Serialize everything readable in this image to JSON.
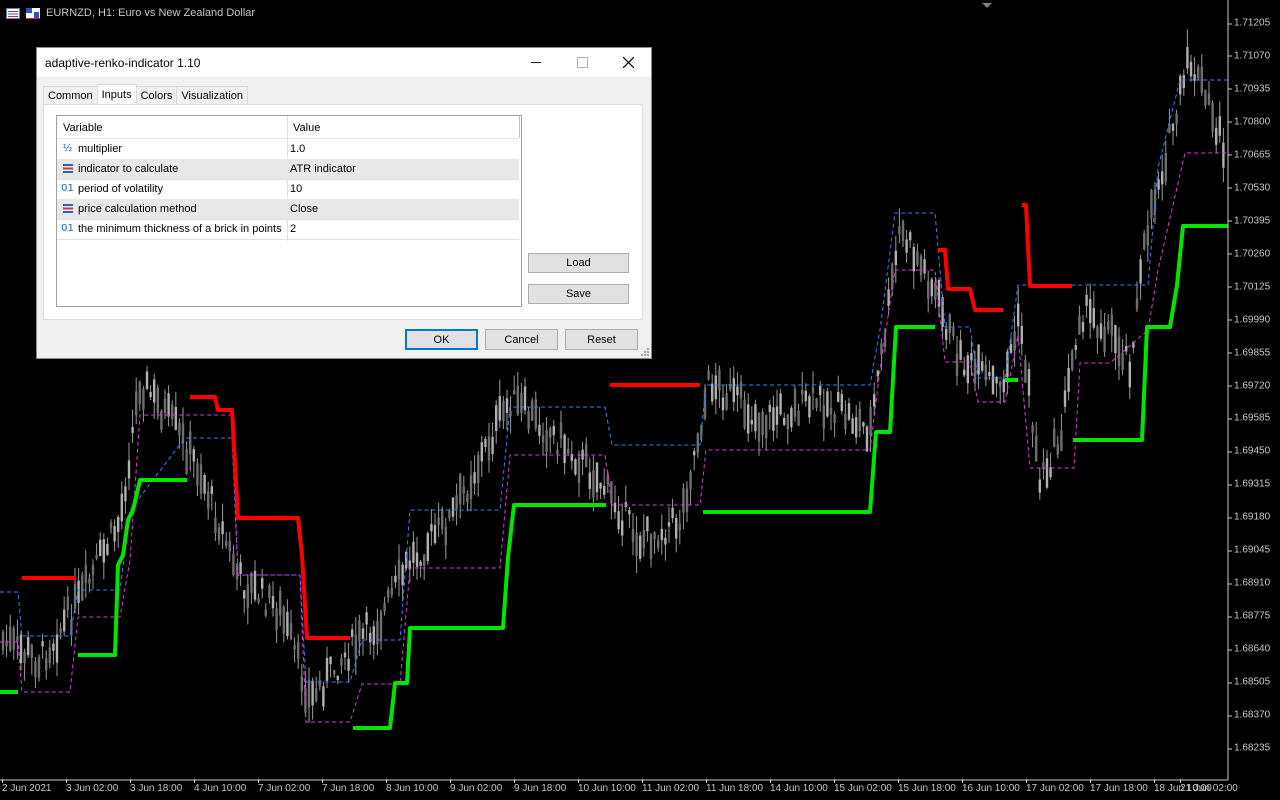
{
  "chart": {
    "symbol_title": "EURNZD, H1:  Euro vs New Zealand Dollar",
    "background": "#000000",
    "candle_color": "#c0c0c0",
    "renko_up_color": "#00e600",
    "renko_down_color": "#ff0000",
    "upper_band_color": "#3c7ff0",
    "lower_band_color": "#d63cd6",
    "price_scale": {
      "min": 1.6815,
      "max": 1.7128
    },
    "price_ticks": [
      "1.71205",
      "1.71070",
      "1.70935",
      "1.70800",
      "1.70665",
      "1.70530",
      "1.70395",
      "1.70260",
      "1.70125",
      "1.69990",
      "1.69855",
      "1.69720",
      "1.69585",
      "1.69450",
      "1.69315",
      "1.69180",
      "1.69045",
      "1.68910",
      "1.68775",
      "1.68640",
      "1.68505",
      "1.68370",
      "1.68235"
    ],
    "time_ticks": [
      "2 Jun 2021",
      "3 Jun 02:00",
      "3 Jun 18:00",
      "4 Jun 10:00",
      "7 Jun 02:00",
      "7 Jun 18:00",
      "8 Jun 10:00",
      "9 Jun 02:00",
      "9 Jun 18:00",
      "10 Jun 10:00",
      "11 Jun 02:00",
      "11 Jun 18:00",
      "14 Jun 10:00",
      "15 Jun 02:00",
      "15 Jun 18:00",
      "16 Jun 10:00",
      "17 Jun 02:00",
      "17 Jun 18:00",
      "18 Jun 10:00",
      "21 Jun 02:00"
    ]
  },
  "dialog": {
    "title": "adaptive-renko-indicator 1.10",
    "tabs": [
      {
        "label": "Common"
      },
      {
        "label": "Inputs"
      },
      {
        "label": "Colors"
      },
      {
        "label": "Visualization"
      }
    ],
    "grid": {
      "header_variable": "Variable",
      "header_value": "Value",
      "rows": [
        {
          "icon": "fraction-icon",
          "name": "multiplier",
          "value": "1.0"
        },
        {
          "icon": "list-icon",
          "name": "indicator to calculate",
          "value": "ATR indicator"
        },
        {
          "icon": "integer-icon",
          "name": "period of volatility",
          "value": "10"
        },
        {
          "icon": "list-icon",
          "name": "price calculation method",
          "value": "Close"
        },
        {
          "icon": "integer-icon",
          "name": "the minimum thickness of a brick in points",
          "value": "2"
        }
      ]
    },
    "buttons": {
      "load": "Load",
      "save": "Save",
      "ok": "OK",
      "cancel": "Cancel",
      "reset": "Reset"
    }
  }
}
